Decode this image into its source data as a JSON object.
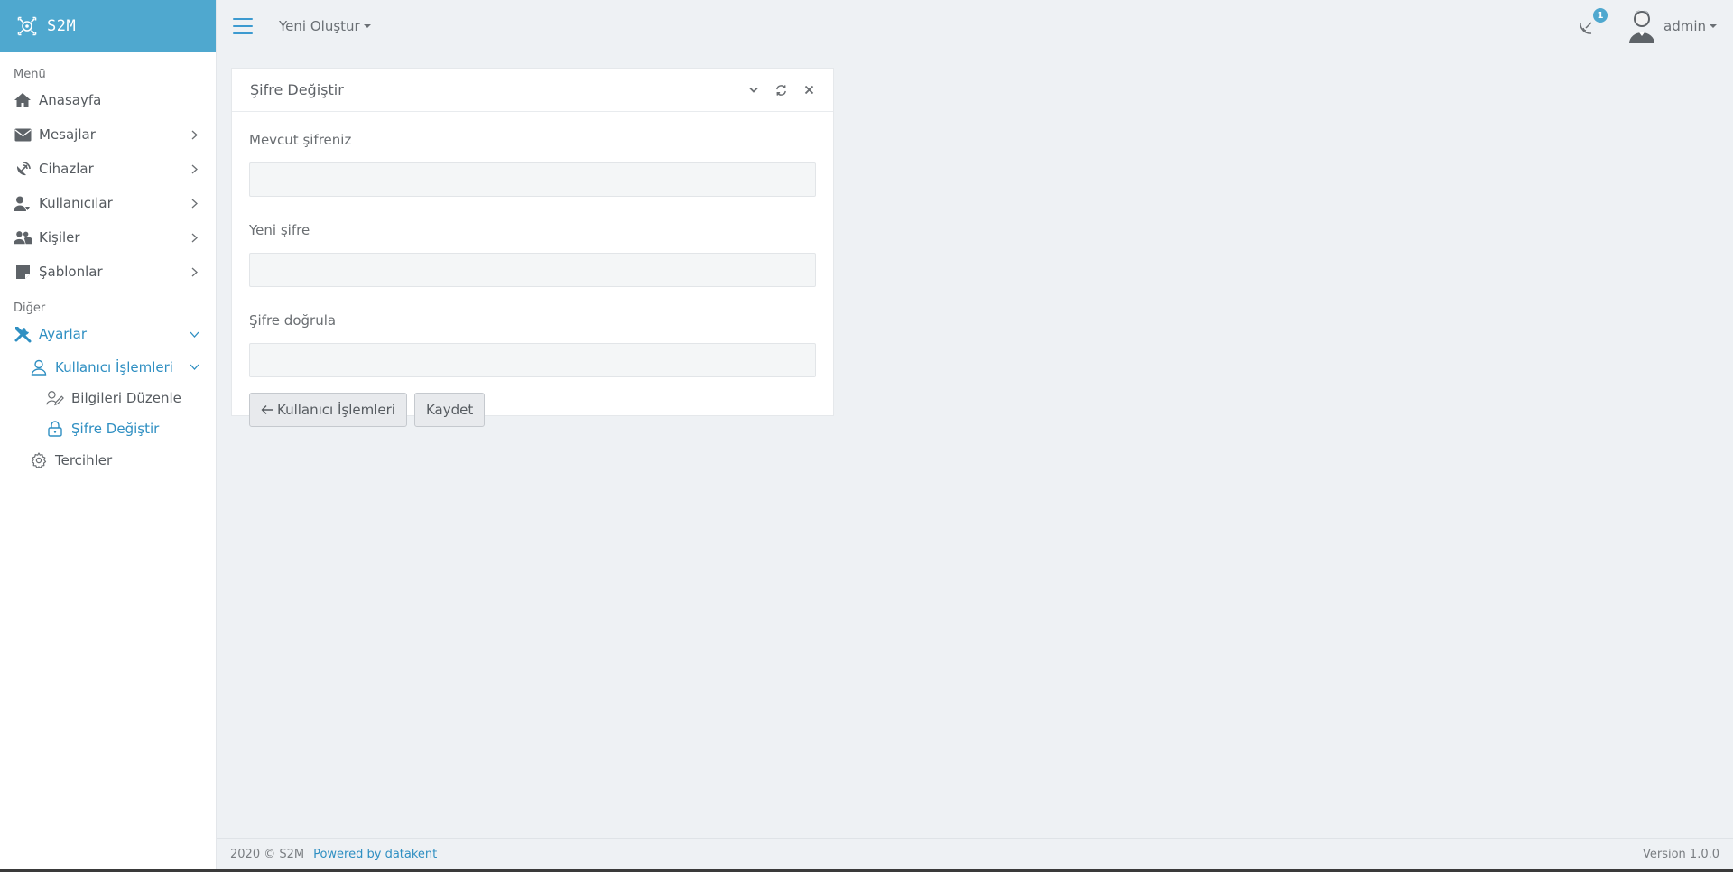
{
  "brand": {
    "name": "S2M"
  },
  "topbar": {
    "new_create_label": "Yeni Oluştur",
    "notification_count": "1",
    "user_name": "admin"
  },
  "sidebar": {
    "menu_label": "Menü",
    "other_label": "Diğer",
    "items": [
      {
        "label": "Anasayfa",
        "icon": "home-icon"
      },
      {
        "label": "Mesajlar",
        "icon": "envelope-icon"
      },
      {
        "label": "Cihazlar",
        "icon": "satellite-dish-icon"
      },
      {
        "label": "Kullanıcılar",
        "icon": "user-icon"
      },
      {
        "label": "Kişiler",
        "icon": "users-icon"
      },
      {
        "label": "Şablonlar",
        "icon": "note-icon"
      }
    ],
    "settings": {
      "label": "Ayarlar",
      "user_ops_label": "Kullanıcı İşlemleri",
      "edit_info_label": "Bilgileri Düzenle",
      "change_password_label": "Şifre Değiştir",
      "preferences_label": "Tercihler"
    }
  },
  "card": {
    "title": "Şifre Değiştir",
    "fields": [
      {
        "label": "Mevcut şifreniz",
        "value": ""
      },
      {
        "label": "Yeni şifre",
        "value": ""
      },
      {
        "label": "Şifre doğrula",
        "value": ""
      }
    ],
    "back_button_label": "Kullanıcı İşlemleri",
    "save_button_label": "Kaydet"
  },
  "footer": {
    "copyright": "2020 © S2M",
    "powered_by": "Powered by datakent",
    "version": "Version 1.0.0"
  },
  "colors": {
    "brand": "#4fa8cf",
    "accent": "#2f8fc2",
    "background": "#eef1f4"
  }
}
